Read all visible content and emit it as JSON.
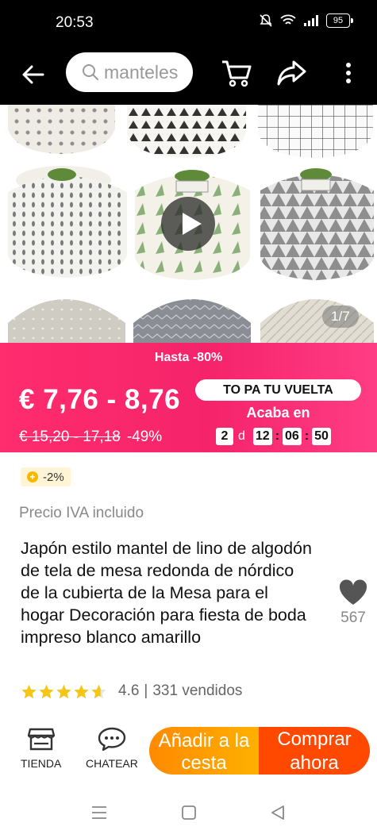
{
  "status": {
    "time": "20:53",
    "battery": "95"
  },
  "topbar": {
    "search_text": "manteles"
  },
  "gallery": {
    "counter": "1/7"
  },
  "promo": {
    "deal": "Hasta -80%",
    "price": "€ 7,76 - 8,76",
    "original_price": "€ 15,20 - 17,18",
    "discount": "-49%",
    "campaign": "TO PA TU VUELTA",
    "ends_label": "Acaba en",
    "countdown": {
      "days": "2",
      "day_unit": "d",
      "hours": "12",
      "minutes": "06",
      "seconds": "50"
    }
  },
  "coupon": {
    "label": "-2%"
  },
  "product": {
    "vat": "Precio IVA incluido",
    "title": "Japón estilo mantel de lino de algodón de tela de mesa redonda de nórdico de la cubierta de la Mesa para el hogar Decoración para fiesta de boda impreso blanco amarillo",
    "favorites": "567",
    "rating": "4.6",
    "rating_value": 4.6,
    "separator": "|",
    "sold": "331 vendidos"
  },
  "bottom": {
    "store": "TIENDA",
    "chat": "CHATEAR",
    "add_to_cart": "Añadir a la cesta",
    "buy_now": "Comprar ahora"
  },
  "colors": {
    "promo": "#f5236a",
    "cta_orange": "#ff9a00",
    "cta_red": "#ff4800",
    "star": "#f5c518"
  }
}
